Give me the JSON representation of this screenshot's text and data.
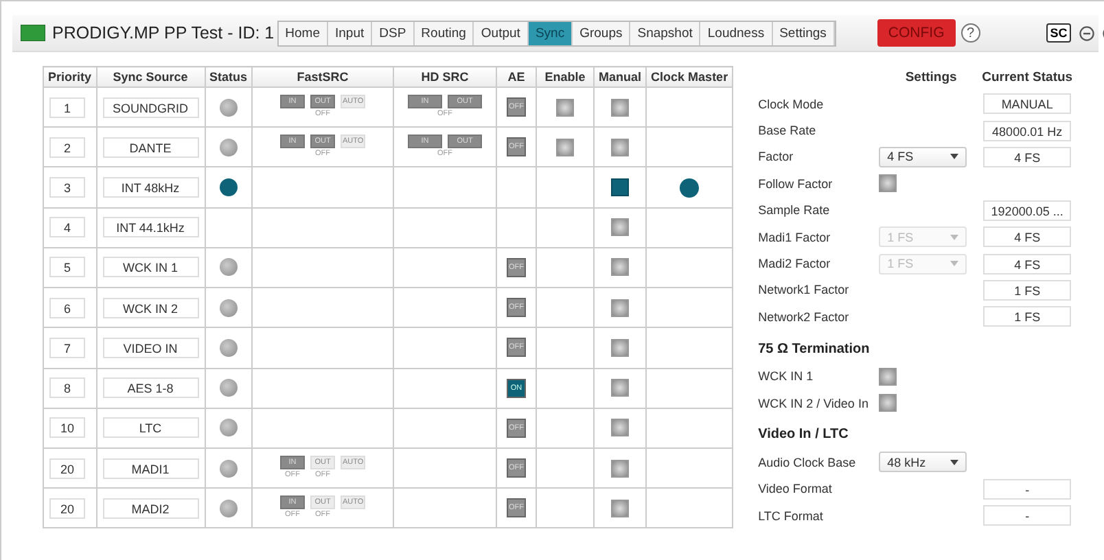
{
  "window": {
    "title": "PRODIGY.MP PP Test - ID: 1"
  },
  "tabs": [
    {
      "label": "Home",
      "selected": false
    },
    {
      "label": "Input",
      "selected": false
    },
    {
      "label": "DSP",
      "selected": false
    },
    {
      "label": "Routing",
      "selected": false
    },
    {
      "label": "Output",
      "selected": false
    },
    {
      "label": "Sync",
      "selected": true
    },
    {
      "label": "Groups",
      "selected": false
    },
    {
      "label": "Snapshot",
      "selected": false
    },
    {
      "label": "Loudness",
      "selected": false
    },
    {
      "label": "Settings",
      "selected": false
    }
  ],
  "config_button": "CONFIG",
  "help_button": "?",
  "sc_button": "SC",
  "table": {
    "columns": [
      "Priority",
      "Sync Source",
      "Status",
      "FastSRC",
      "HD SRC",
      "AE",
      "Enable",
      "Manual",
      "Clock Master"
    ],
    "rows": [
      {
        "priority": "1",
        "source": "SOUNDGRID",
        "status": {
          "locked": false
        },
        "fastsrc": {
          "buttons": [
            {
              "label": "IN",
              "disabled": false
            },
            {
              "label": "OUT",
              "disabled": false
            },
            {
              "label": "AUTO",
              "disabled": true
            }
          ],
          "state": "OFF"
        },
        "hdsrc": {
          "buttons": [
            {
              "label": "IN",
              "disabled": false
            },
            {
              "label": "OUT",
              "disabled": false
            }
          ],
          "state": "OFF"
        },
        "ae": {
          "label": "OFF",
          "on": false
        },
        "enable": {
          "checked": false
        },
        "manual": {
          "checked": false
        },
        "clock_master": false
      },
      {
        "priority": "2",
        "source": "DANTE",
        "status": {
          "locked": false
        },
        "fastsrc": {
          "buttons": [
            {
              "label": "IN",
              "disabled": false
            },
            {
              "label": "OUT",
              "disabled": false
            },
            {
              "label": "AUTO",
              "disabled": true
            }
          ],
          "state": "OFF"
        },
        "hdsrc": {
          "buttons": [
            {
              "label": "IN",
              "disabled": false
            },
            {
              "label": "OUT",
              "disabled": false
            }
          ],
          "state": "OFF"
        },
        "ae": {
          "label": "OFF",
          "on": false
        },
        "enable": {
          "checked": false
        },
        "manual": {
          "checked": false
        },
        "clock_master": false
      },
      {
        "priority": "3",
        "source": "INT 48kHz",
        "status": {
          "locked": true
        },
        "manual": {
          "checked": true
        },
        "clock_master": true
      },
      {
        "priority": "4",
        "source": "INT 44.1kHz",
        "manual": {
          "checked": false
        },
        "clock_master": false
      },
      {
        "priority": "5",
        "source": "WCK IN 1",
        "status": {
          "locked": false
        },
        "ae": {
          "label": "OFF",
          "on": false
        },
        "manual": {
          "checked": false
        },
        "clock_master": false
      },
      {
        "priority": "6",
        "source": "WCK IN 2",
        "status": {
          "locked": false
        },
        "ae": {
          "label": "OFF",
          "on": false
        },
        "manual": {
          "checked": false
        },
        "clock_master": false
      },
      {
        "priority": "7",
        "source": "VIDEO IN",
        "status": {
          "locked": false
        },
        "ae": {
          "label": "OFF",
          "on": false
        },
        "manual": {
          "checked": false
        },
        "clock_master": false
      },
      {
        "priority": "8",
        "source": "AES 1-8",
        "status": {
          "locked": false
        },
        "ae": {
          "label": "ON",
          "on": true
        },
        "manual": {
          "checked": false
        },
        "clock_master": false
      },
      {
        "priority": "10",
        "source": "LTC",
        "status": {
          "locked": false
        },
        "ae": {
          "label": "OFF",
          "on": false
        },
        "manual": {
          "checked": false
        },
        "clock_master": false
      },
      {
        "priority": "20",
        "source": "MADI1",
        "status": {
          "locked": false
        },
        "fastsrc": {
          "buttons": [
            {
              "label": "IN",
              "disabled": false,
              "caption": "OFF"
            },
            {
              "label": "OUT",
              "disabled": true,
              "caption": "OFF"
            },
            {
              "label": "AUTO",
              "disabled": true
            }
          ]
        },
        "ae": {
          "label": "OFF",
          "on": false
        },
        "manual": {
          "checked": false
        },
        "clock_master": false
      },
      {
        "priority": "20",
        "source": "MADI2",
        "status": {
          "locked": false
        },
        "fastsrc": {
          "buttons": [
            {
              "label": "IN",
              "disabled": false,
              "caption": "OFF"
            },
            {
              "label": "OUT",
              "disabled": true,
              "caption": "OFF"
            },
            {
              "label": "AUTO",
              "disabled": true
            }
          ]
        },
        "ae": {
          "label": "OFF",
          "on": false
        },
        "manual": {
          "checked": false
        },
        "clock_master": false
      }
    ]
  },
  "settings": {
    "headings": [
      "Settings",
      "Current Status"
    ],
    "rows": [
      {
        "label": "Clock Mode",
        "kind": "none",
        "status": "MANUAL"
      },
      {
        "label": "Base Rate",
        "kind": "none",
        "status": "48000.01 Hz"
      },
      {
        "label": "Factor",
        "kind": "select",
        "value": "4 FS",
        "disabled": false,
        "status": "4 FS"
      },
      {
        "label": "Follow Factor",
        "kind": "checkbox",
        "checked": false
      },
      {
        "label": "Sample Rate",
        "kind": "none",
        "status": "192000.05 ..."
      },
      {
        "label": "Madi1 Factor",
        "kind": "select",
        "value": "1 FS",
        "disabled": true,
        "status": "4 FS"
      },
      {
        "label": "Madi2 Factor",
        "kind": "select",
        "value": "1 FS",
        "disabled": true,
        "status": "4 FS"
      },
      {
        "label": "Network1 Factor",
        "kind": "none",
        "status": "1 FS"
      },
      {
        "label": "Network2 Factor",
        "kind": "none",
        "status": "1 FS"
      }
    ]
  },
  "termination": {
    "title": "75 Ω Termination",
    "rows": [
      {
        "label": "WCK IN 1",
        "kind": "checkbox",
        "checked": false
      },
      {
        "label": "WCK IN 2 / Video In",
        "kind": "checkbox",
        "checked": false
      }
    ]
  },
  "video": {
    "title": "Video In / LTC",
    "rows": [
      {
        "label": "Audio Clock Base",
        "kind": "select",
        "value": "48 kHz",
        "disabled": false
      },
      {
        "label": "Video Format",
        "kind": "none",
        "status": "-"
      },
      {
        "label": "LTC Format",
        "kind": "none",
        "status": "-"
      }
    ]
  }
}
